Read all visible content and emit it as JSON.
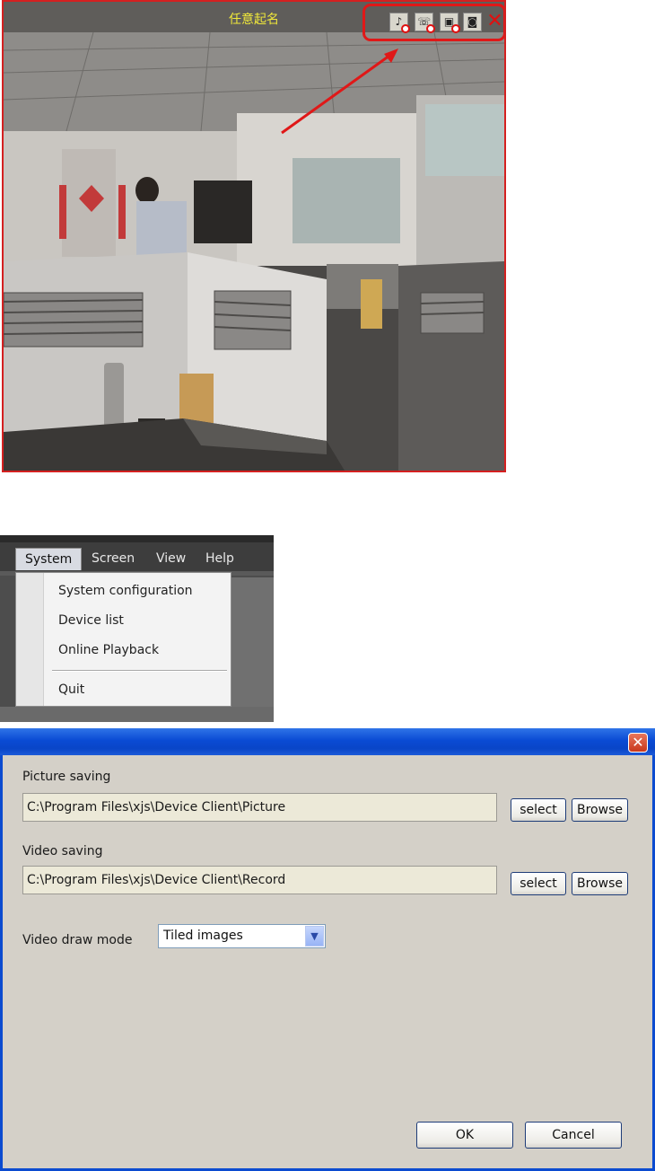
{
  "camera": {
    "title": "任意起名",
    "toolbar_icons": [
      "mute-audio-icon",
      "stop-talk-icon",
      "stop-record-icon",
      "snapshot-icon",
      "close-icon"
    ],
    "accent": "#e01818",
    "title_color": "#f0e83a"
  },
  "menu": {
    "top_items": [
      "System",
      "Screen",
      "View",
      "Help"
    ],
    "dropdown": [
      "System configuration",
      "Device list",
      "Online Playback",
      "Quit"
    ]
  },
  "dialog": {
    "close_icon": "close-icon",
    "picture_label": "Picture saving",
    "picture_path": "C:\\Program Files\\xjs\\Device Client\\Picture",
    "video_label": "Video saving",
    "video_path": "C:\\Program Files\\xjs\\Device Client\\Record",
    "select_label": "select",
    "browse_label": "Browse",
    "draw_mode_label": "Video draw mode",
    "draw_mode_value": "Tiled images",
    "ok_label": "OK",
    "cancel_label": "Cancel"
  }
}
